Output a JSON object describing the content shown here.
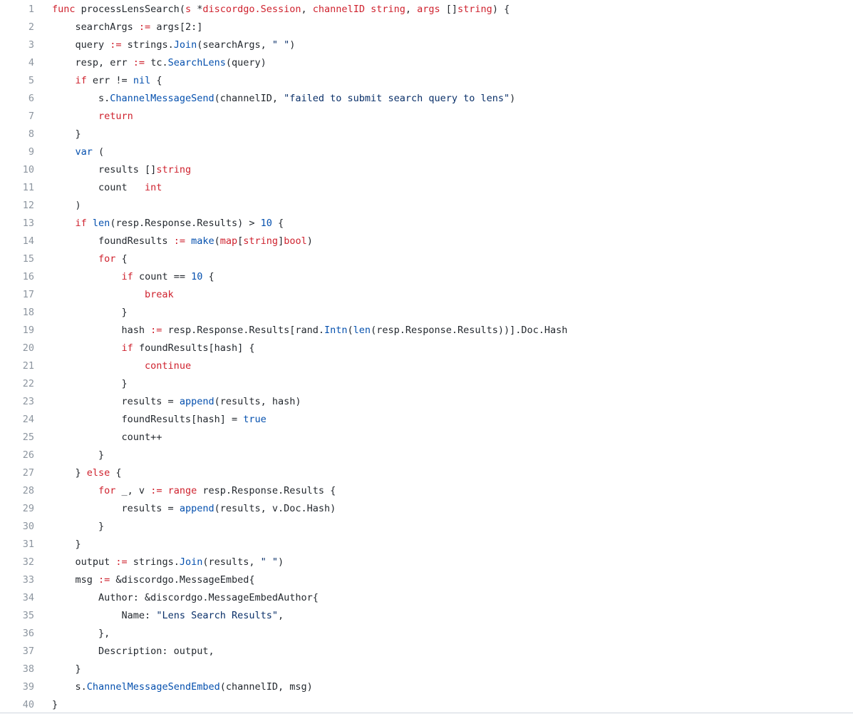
{
  "code_view": {
    "language": "go",
    "colors": {
      "keyword": "#cf222e",
      "function_call": "#0550ae",
      "string": "#0a3069",
      "number": "#0550ae",
      "plain": "#24292f",
      "line_number": "#8c959f"
    },
    "lines": [
      {
        "n": "1",
        "tokens": [
          [
            "kw",
            "func"
          ],
          [
            "plain",
            " processLensSearch("
          ],
          [
            "kw",
            "s"
          ],
          [
            "plain",
            " *"
          ],
          [
            "kw",
            "discordgo.Session"
          ],
          [
            "plain",
            ", "
          ],
          [
            "kw",
            "channelID"
          ],
          [
            "plain",
            " "
          ],
          [
            "kw",
            "string"
          ],
          [
            "plain",
            ", "
          ],
          [
            "kw",
            "args"
          ],
          [
            "plain",
            " []"
          ],
          [
            "kw",
            "string"
          ],
          [
            "plain",
            ") {"
          ]
        ]
      },
      {
        "n": "2",
        "tokens": [
          [
            "plain",
            "    searchArgs "
          ],
          [
            "kw",
            ":="
          ],
          [
            "plain",
            " args[2:]"
          ]
        ]
      },
      {
        "n": "3",
        "tokens": [
          [
            "plain",
            "    query "
          ],
          [
            "kw",
            ":="
          ],
          [
            "plain",
            " strings."
          ],
          [
            "blue",
            "Join"
          ],
          [
            "plain",
            "(searchArgs, "
          ],
          [
            "str",
            "\" \""
          ],
          [
            "plain",
            ")"
          ]
        ]
      },
      {
        "n": "4",
        "tokens": [
          [
            "plain",
            "    resp, err "
          ],
          [
            "kw",
            ":="
          ],
          [
            "plain",
            " tc."
          ],
          [
            "blue",
            "SearchLens"
          ],
          [
            "plain",
            "(query)"
          ]
        ]
      },
      {
        "n": "5",
        "tokens": [
          [
            "plain",
            "    "
          ],
          [
            "kw",
            "if"
          ],
          [
            "plain",
            " err != "
          ],
          [
            "blue",
            "nil"
          ],
          [
            "plain",
            " {"
          ]
        ]
      },
      {
        "n": "6",
        "tokens": [
          [
            "plain",
            "        s."
          ],
          [
            "blue",
            "ChannelMessageSend"
          ],
          [
            "plain",
            "(channelID, "
          ],
          [
            "str",
            "\"failed to submit search query to lens\""
          ],
          [
            "plain",
            ")"
          ]
        ]
      },
      {
        "n": "7",
        "tokens": [
          [
            "plain",
            "        "
          ],
          [
            "kw",
            "return"
          ]
        ]
      },
      {
        "n": "8",
        "tokens": [
          [
            "plain",
            "    }"
          ]
        ]
      },
      {
        "n": "9",
        "tokens": [
          [
            "plain",
            "    "
          ],
          [
            "blue",
            "var"
          ],
          [
            "plain",
            " ("
          ]
        ]
      },
      {
        "n": "10",
        "tokens": [
          [
            "plain",
            "        results []"
          ],
          [
            "kw",
            "string"
          ]
        ]
      },
      {
        "n": "11",
        "tokens": [
          [
            "plain",
            "        count   "
          ],
          [
            "kw",
            "int"
          ]
        ]
      },
      {
        "n": "12",
        "tokens": [
          [
            "plain",
            "    )"
          ]
        ]
      },
      {
        "n": "13",
        "tokens": [
          [
            "plain",
            "    "
          ],
          [
            "kw",
            "if"
          ],
          [
            "plain",
            " "
          ],
          [
            "blue",
            "len"
          ],
          [
            "plain",
            "(resp.Response.Results) > "
          ],
          [
            "num",
            "10"
          ],
          [
            "plain",
            " {"
          ]
        ]
      },
      {
        "n": "14",
        "tokens": [
          [
            "plain",
            "        foundResults "
          ],
          [
            "kw",
            ":="
          ],
          [
            "plain",
            " "
          ],
          [
            "blue",
            "make"
          ],
          [
            "plain",
            "("
          ],
          [
            "kw",
            "map"
          ],
          [
            "plain",
            "["
          ],
          [
            "kw",
            "string"
          ],
          [
            "plain",
            "]"
          ],
          [
            "kw",
            "bool"
          ],
          [
            "plain",
            ")"
          ]
        ]
      },
      {
        "n": "15",
        "tokens": [
          [
            "plain",
            "        "
          ],
          [
            "kw",
            "for"
          ],
          [
            "plain",
            " {"
          ]
        ]
      },
      {
        "n": "16",
        "tokens": [
          [
            "plain",
            "            "
          ],
          [
            "kw",
            "if"
          ],
          [
            "plain",
            " count == "
          ],
          [
            "num",
            "10"
          ],
          [
            "plain",
            " {"
          ]
        ]
      },
      {
        "n": "17",
        "tokens": [
          [
            "plain",
            "                "
          ],
          [
            "kw",
            "break"
          ]
        ]
      },
      {
        "n": "18",
        "tokens": [
          [
            "plain",
            "            }"
          ]
        ]
      },
      {
        "n": "19",
        "tokens": [
          [
            "plain",
            "            hash "
          ],
          [
            "kw",
            ":="
          ],
          [
            "plain",
            " resp.Response.Results[rand."
          ],
          [
            "blue",
            "Intn"
          ],
          [
            "plain",
            "("
          ],
          [
            "blue",
            "len"
          ],
          [
            "plain",
            "(resp.Response.Results))].Doc.Hash"
          ]
        ]
      },
      {
        "n": "20",
        "tokens": [
          [
            "plain",
            "            "
          ],
          [
            "kw",
            "if"
          ],
          [
            "plain",
            " foundResults[hash] {"
          ]
        ]
      },
      {
        "n": "21",
        "tokens": [
          [
            "plain",
            "                "
          ],
          [
            "kw",
            "continue"
          ]
        ]
      },
      {
        "n": "22",
        "tokens": [
          [
            "plain",
            "            }"
          ]
        ]
      },
      {
        "n": "23",
        "tokens": [
          [
            "plain",
            "            results = "
          ],
          [
            "blue",
            "append"
          ],
          [
            "plain",
            "(results, hash)"
          ]
        ]
      },
      {
        "n": "24",
        "tokens": [
          [
            "plain",
            "            foundResults[hash] = "
          ],
          [
            "blue",
            "true"
          ]
        ]
      },
      {
        "n": "25",
        "tokens": [
          [
            "plain",
            "            count++"
          ]
        ]
      },
      {
        "n": "26",
        "tokens": [
          [
            "plain",
            "        }"
          ]
        ]
      },
      {
        "n": "27",
        "tokens": [
          [
            "plain",
            "    } "
          ],
          [
            "kw",
            "else"
          ],
          [
            "plain",
            " {"
          ]
        ]
      },
      {
        "n": "28",
        "tokens": [
          [
            "plain",
            "        "
          ],
          [
            "kw",
            "for"
          ],
          [
            "plain",
            " _, v "
          ],
          [
            "kw",
            ":="
          ],
          [
            "plain",
            " "
          ],
          [
            "kw",
            "range"
          ],
          [
            "plain",
            " resp.Response.Results {"
          ]
        ]
      },
      {
        "n": "29",
        "tokens": [
          [
            "plain",
            "            results = "
          ],
          [
            "blue",
            "append"
          ],
          [
            "plain",
            "(results, v.Doc.Hash)"
          ]
        ]
      },
      {
        "n": "30",
        "tokens": [
          [
            "plain",
            "        }"
          ]
        ]
      },
      {
        "n": "31",
        "tokens": [
          [
            "plain",
            "    }"
          ]
        ]
      },
      {
        "n": "32",
        "tokens": [
          [
            "plain",
            "    output "
          ],
          [
            "kw",
            ":="
          ],
          [
            "plain",
            " strings."
          ],
          [
            "blue",
            "Join"
          ],
          [
            "plain",
            "(results, "
          ],
          [
            "str",
            "\" \""
          ],
          [
            "plain",
            ")"
          ]
        ]
      },
      {
        "n": "33",
        "tokens": [
          [
            "plain",
            "    msg "
          ],
          [
            "kw",
            ":="
          ],
          [
            "plain",
            " &discordgo.MessageEmbed{"
          ]
        ]
      },
      {
        "n": "34",
        "tokens": [
          [
            "plain",
            "        Author: &discordgo.MessageEmbedAuthor{"
          ]
        ]
      },
      {
        "n": "35",
        "tokens": [
          [
            "plain",
            "            Name: "
          ],
          [
            "str",
            "\"Lens Search Results\""
          ],
          [
            "plain",
            ","
          ]
        ]
      },
      {
        "n": "36",
        "tokens": [
          [
            "plain",
            "        },"
          ]
        ]
      },
      {
        "n": "37",
        "tokens": [
          [
            "plain",
            "        Description: output,"
          ]
        ]
      },
      {
        "n": "38",
        "tokens": [
          [
            "plain",
            "    }"
          ]
        ]
      },
      {
        "n": "39",
        "tokens": [
          [
            "plain",
            "    s."
          ],
          [
            "blue",
            "ChannelMessageSendEmbed"
          ],
          [
            "plain",
            "(channelID, msg)"
          ]
        ]
      },
      {
        "n": "40",
        "tokens": [
          [
            "plain",
            "}"
          ]
        ]
      }
    ]
  }
}
